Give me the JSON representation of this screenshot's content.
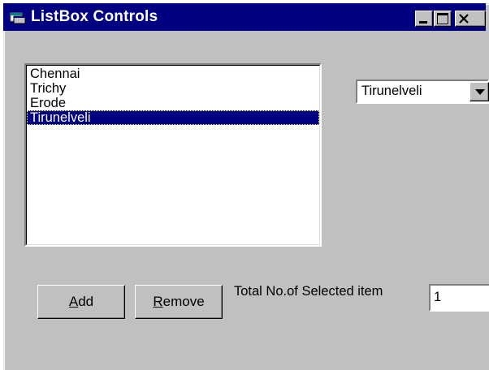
{
  "window": {
    "title": "ListBox Controls",
    "icon": "app-window-icon",
    "controls": [
      "minimize-icon",
      "maximize-icon",
      "close-icon"
    ]
  },
  "listbox": {
    "items": [
      "Chennai",
      "Trichy",
      "Erode",
      "Tirunelveli"
    ],
    "selected_index": 3
  },
  "combo": {
    "value": "Tirunelveli"
  },
  "buttons": {
    "add": {
      "accel": "A",
      "rest": "dd"
    },
    "remove": {
      "accel": "R",
      "rest": "emove"
    }
  },
  "total": {
    "label": "Total No.of Selected item",
    "value": "1"
  },
  "colors": {
    "titlebar": "#000080",
    "face": "#c0c0c0",
    "selection": "#000080"
  }
}
